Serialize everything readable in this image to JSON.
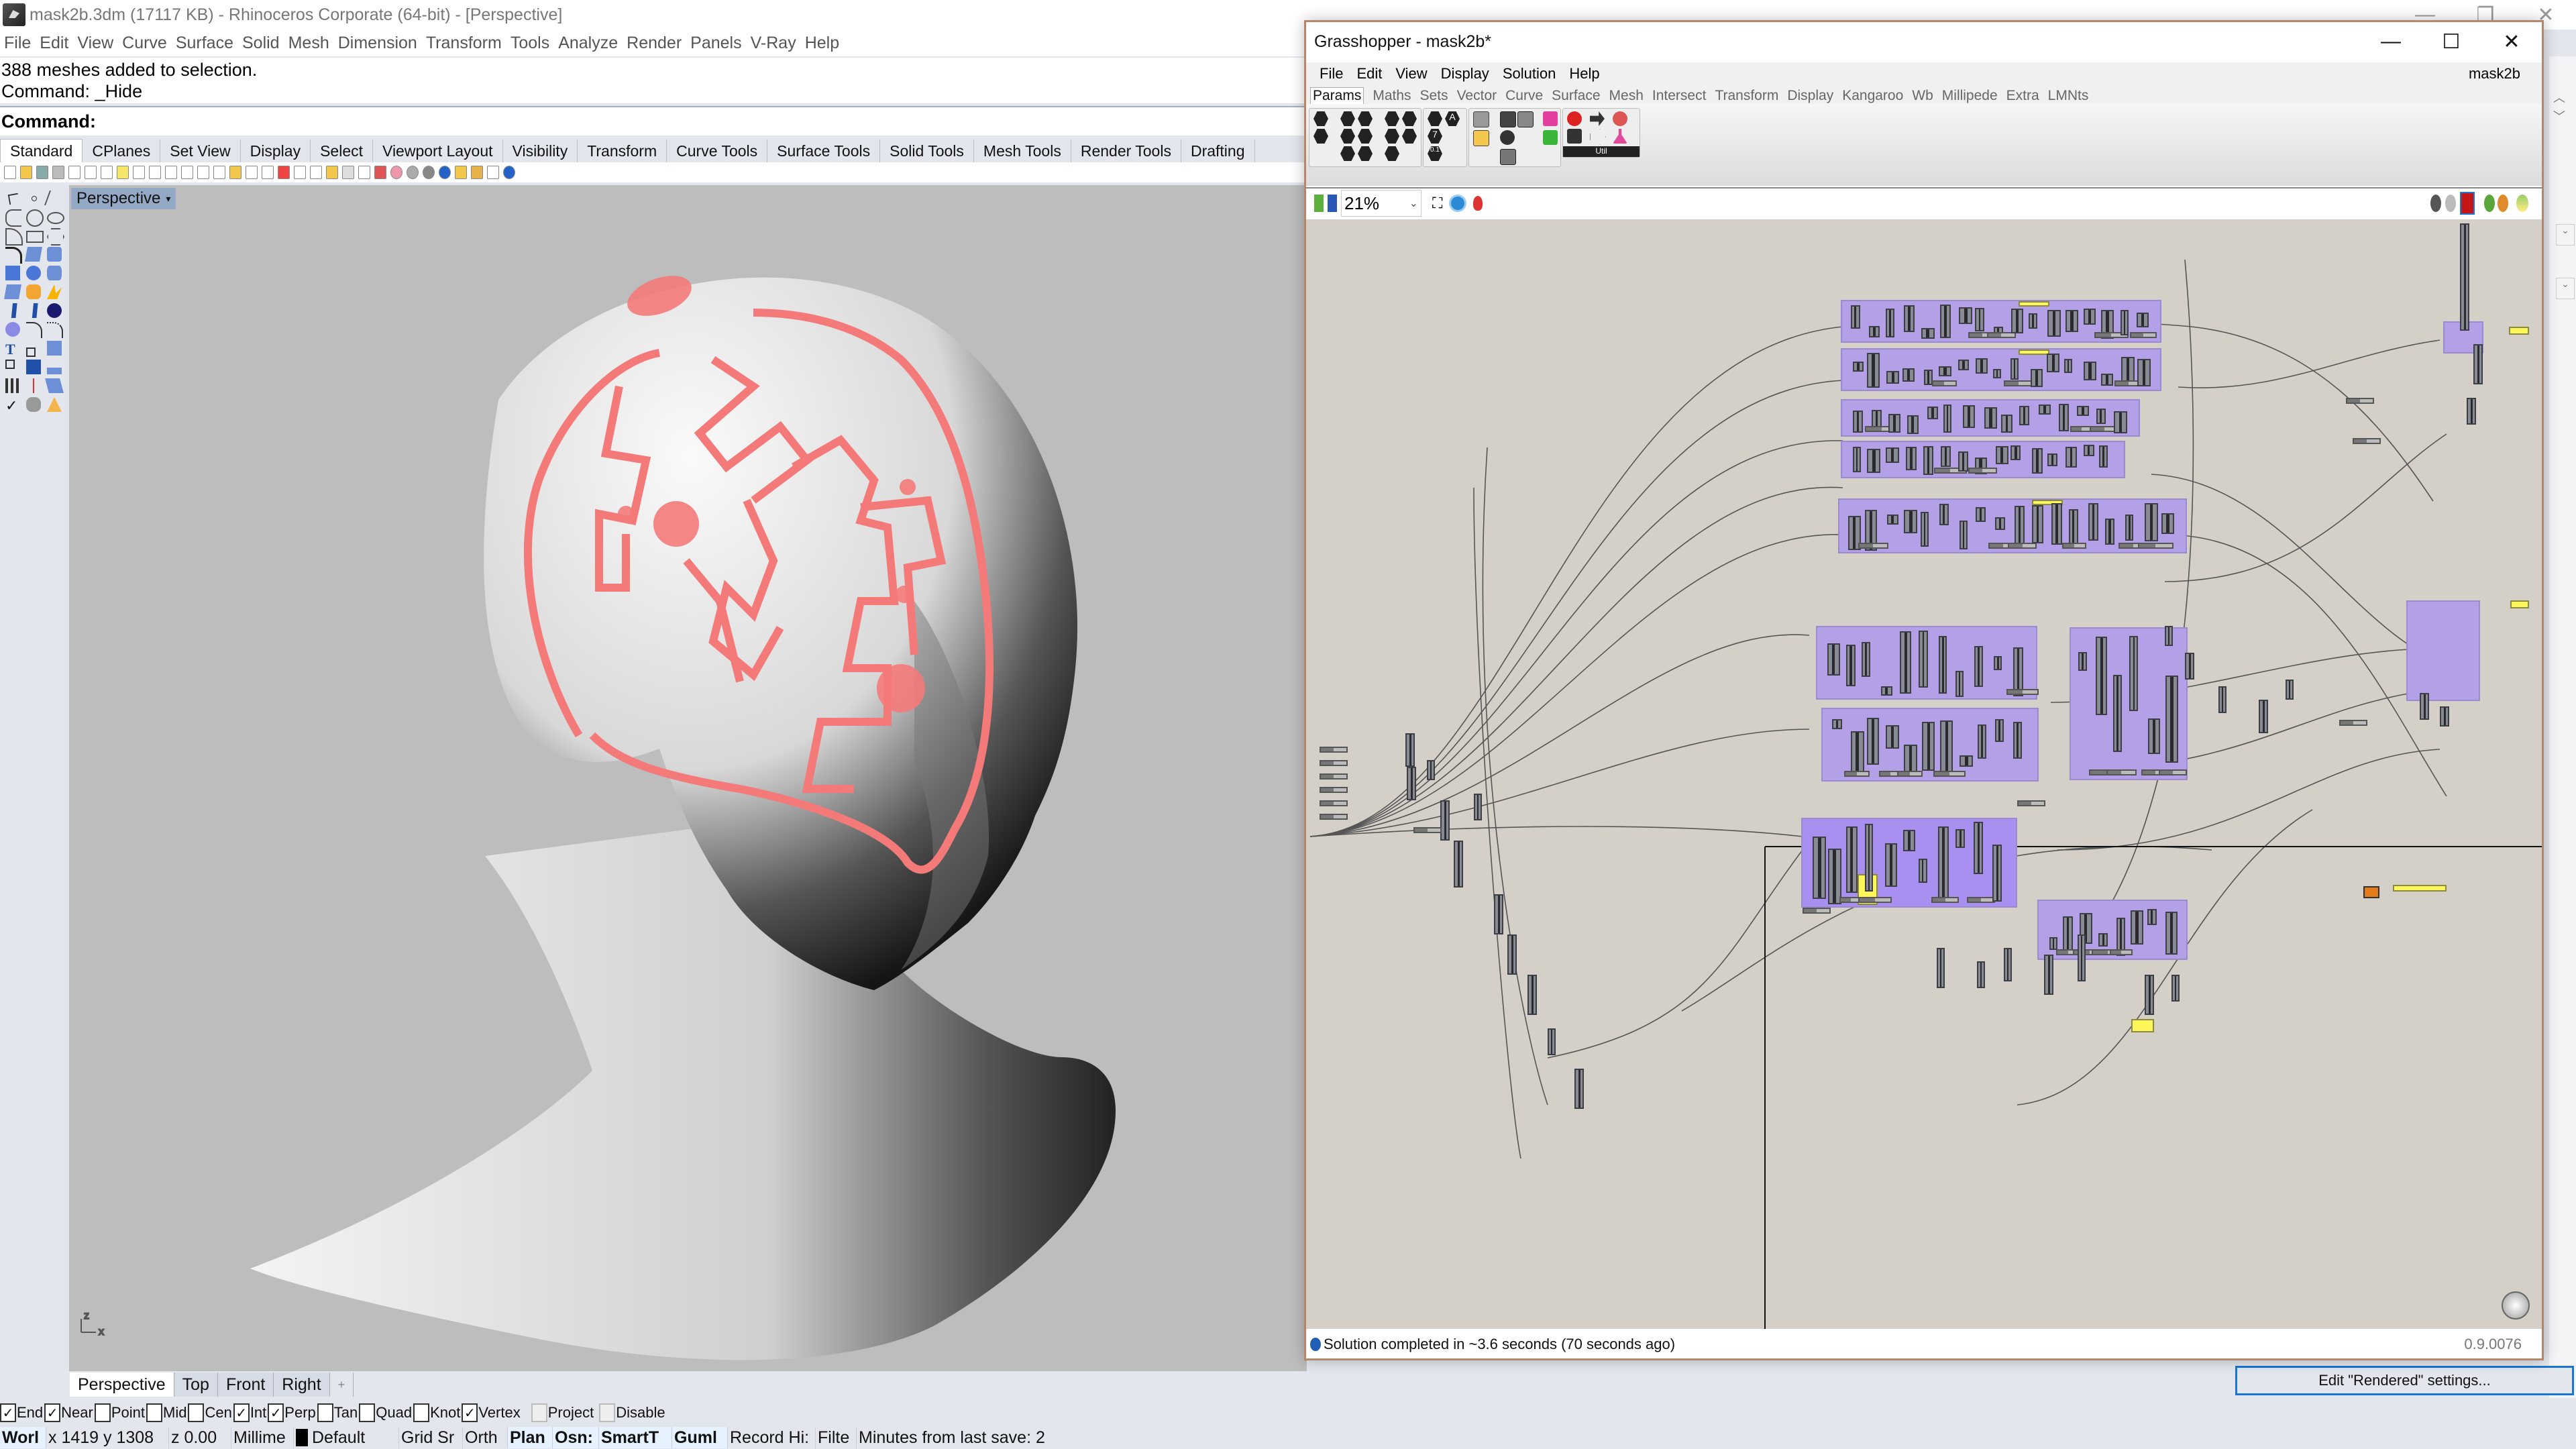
{
  "rhino": {
    "title": "mask2b.3dm (17117 KB) - Rhinoceros Corporate (64-bit) - [Perspective]",
    "menu": [
      "File",
      "Edit",
      "View",
      "Curve",
      "Surface",
      "Solid",
      "Mesh",
      "Dimension",
      "Transform",
      "Tools",
      "Analyze",
      "Render",
      "Panels",
      "V-Ray",
      "Help"
    ],
    "history": [
      "388 meshes added to selection.",
      "Command: _Hide"
    ],
    "command_prompt": "Command:",
    "command_value": "",
    "toolbar_tabs": [
      "Standard",
      "CPlanes",
      "Set View",
      "Display",
      "Select",
      "Viewport Layout",
      "Visibility",
      "Transform",
      "Curve Tools",
      "Surface Tools",
      "Solid Tools",
      "Mesh Tools",
      "Render Tools",
      "Drafting"
    ],
    "active_toolbar_tab": "Standard",
    "viewport_label": "Perspective",
    "view_tabs": [
      "Perspective",
      "Top",
      "Front",
      "Right"
    ],
    "add_view_tab": "+",
    "osnaps": [
      {
        "label": "End",
        "checked": true
      },
      {
        "label": "Near",
        "checked": true
      },
      {
        "label": "Point",
        "checked": false
      },
      {
        "label": "Mid",
        "checked": false
      },
      {
        "label": "Cen",
        "checked": false
      },
      {
        "label": "Int",
        "checked": true
      },
      {
        "label": "Perp",
        "checked": true
      },
      {
        "label": "Tan",
        "checked": false
      },
      {
        "label": "Quad",
        "checked": false
      },
      {
        "label": "Knot",
        "checked": false
      },
      {
        "label": "Vertex",
        "checked": true
      },
      {
        "label": "Project",
        "checked": false,
        "disabled": true
      },
      {
        "label": "Disable",
        "checked": false,
        "disabled": true
      }
    ],
    "status": {
      "cplane": "Worl",
      "coords": "x 1419 y 1308",
      "z": "z 0.00",
      "units": "Millime",
      "layer": "Default",
      "grid_snap": "Grid Sr",
      "ortho": "Orth",
      "planar": "Plan",
      "osnap": "Osn:",
      "smarttrack": "SmartT",
      "gumball": "Guml",
      "record_history": "Record Hi:",
      "filter": "Filte",
      "save_info": "Minutes from last save: 2"
    },
    "edit_rendered_button": "Edit \"Rendered\" settings...",
    "colors": {
      "selection_highlight": "#f47a7a",
      "viewport_bg": "#bdbdbd",
      "layer_swatch": "#000000"
    }
  },
  "grasshopper": {
    "title": "Grasshopper - mask2b*",
    "menu": [
      "File",
      "Edit",
      "View",
      "Display",
      "Solution",
      "Help"
    ],
    "document_name": "mask2b",
    "tabs": [
      "Params",
      "Maths",
      "Sets",
      "Vector",
      "Curve",
      "Surface",
      "Mesh",
      "Intersect",
      "Transform",
      "Display",
      "Kangaroo",
      "Wb",
      "Millipede",
      "Extra",
      "LMNts"
    ],
    "active_tab": "Params",
    "ribbon_panel_util": "Util",
    "zoom_level": "21%",
    "status": "Solution completed in ~3.6 seconds (70 seconds ago)",
    "version": "0.9.0076",
    "colors": {
      "canvas": "#d4d0c8",
      "group": "#b3a0e6",
      "panel": "#fff75a",
      "component": "#888a94"
    }
  }
}
